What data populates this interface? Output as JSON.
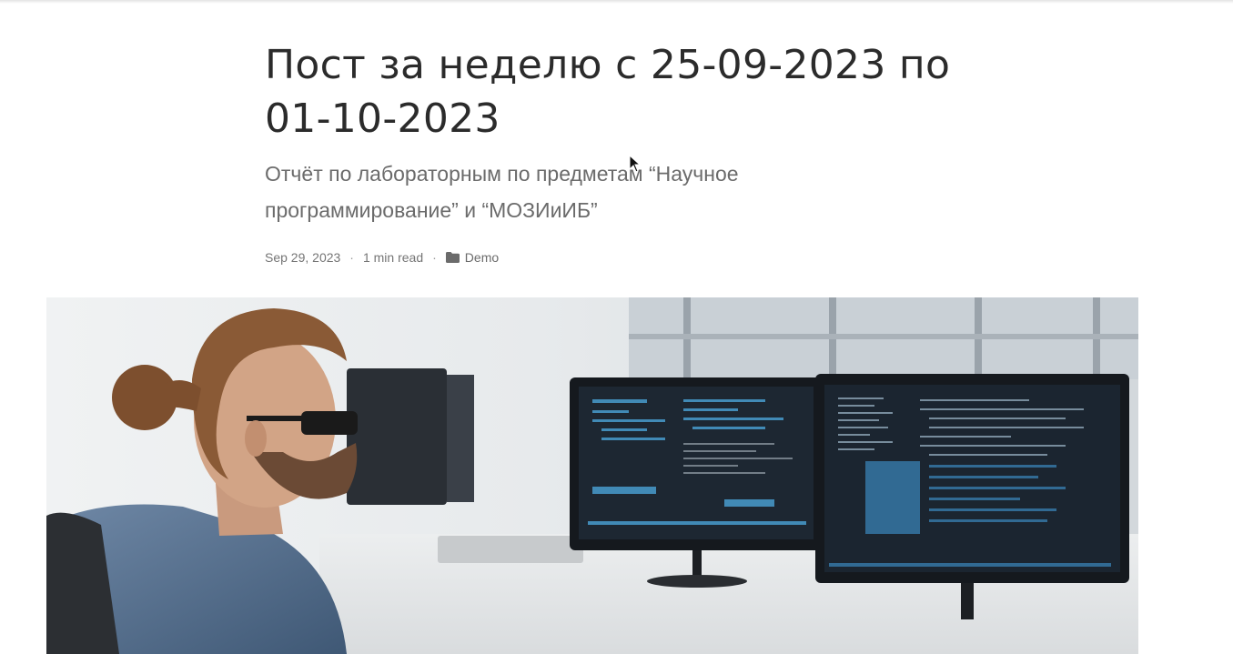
{
  "post": {
    "title": "Пост за неделю с 25-09-2023 по 01-10-2023",
    "subtitle": "Отчёт по лабораторным по предметам “Научное программирование” и “МОЗИиИБ”",
    "date": "Sep 29, 2023",
    "read_time": "1 min read",
    "separator": "·",
    "category": "Demo",
    "category_icon": "folder-icon"
  },
  "hero_image": {
    "icon": "programmer-at-monitors-photo"
  },
  "colors": {
    "title": "#2b2b2b",
    "subtitle": "#6b6b6b",
    "meta": "#757575"
  }
}
